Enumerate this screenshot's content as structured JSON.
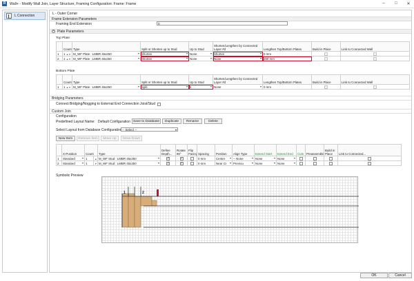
{
  "window": {
    "title": "Wall+ - Modify Wall Join, Layer Structure, Framing Configuration: Frame: Frame",
    "app_icon": "R",
    "minimize": "–",
    "maximize": "□",
    "close": "✕"
  },
  "sidebar": {
    "items": [
      {
        "label": "L Connection",
        "selected": true
      }
    ]
  },
  "header": {
    "title": "L - Outer Corner"
  },
  "frame_extension": {
    "title": "Frame Extension Parameters",
    "label": "Framing End Extension",
    "value": "0"
  },
  "plate_parameters": {
    "title": "Plate Parameters",
    "collapse_icon": "⌃",
    "columns": [
      "Count",
      "Type",
      "Split or Shorten up to Stud",
      "Up to Stud",
      "Shorten/Lengthen by Connected Layer #d",
      "Lengthen Top/Bottom Plates",
      "Build in Place",
      "Link to Connected Wall"
    ],
    "top_plate": {
      "title": "Top Plate",
      "rows": [
        {
          "num": "1",
          "count": "1",
          "type": "M_WF Plate : LMBR 45x250",
          "split": "Shorten",
          "up_to": "None",
          "shorten": "Shorten",
          "lengthen": "0 mm"
        },
        {
          "num": "2",
          "count": "1",
          "type": "M_WF Plate : LMBR 45x250",
          "split": "Shorten",
          "up_to": "None",
          "shorten": "None",
          "lengthen": "250 mm"
        }
      ]
    },
    "bottom_plate": {
      "title": "Bottom Plate",
      "rows": [
        {
          "num": "1",
          "count": "1",
          "type": "M_WF Plate : LMBR 45x250",
          "split": "Split",
          "up_to": "5",
          "shorten": "None",
          "lengthen": "0 mm"
        }
      ]
    }
  },
  "bridging": {
    "title": "Bridging Parameters",
    "label": "Connect Bridging/Nogging to External End Connection Joist/Stud"
  },
  "custom_join": {
    "title": "Custom Join",
    "configuration": {
      "title": "Configuration",
      "predefined_label": "Predefined Layout Name:",
      "predefined_value": "Default Configuration",
      "buttons": [
        "Save to Database",
        "Duplicate",
        "Rename",
        "Delete"
      ],
      "select_label": "Select Layout from Database Configuration:",
      "select_value": "-- Select --"
    },
    "item_buttons": [
      "New Item",
      "Remove Item",
      "Move Up",
      "Move Down"
    ],
    "columns": [
      "X-Position",
      "Count",
      "Type",
      "Define Depth...",
      "Rotate 90°",
      "Flip Facing",
      "Spacing",
      "Position",
      "Align Type",
      "Extend Start",
      "Extend End",
      "Cuts",
      "Preassembled",
      "Build in Place",
      "Link to Connected..."
    ],
    "rows": [
      {
        "num": "1",
        "xpos": "Standard",
        "count": "1",
        "type": "M_WF Stud : LMBR 45x250",
        "spacing": "0 mm",
        "position": "Center",
        "align": "-- None",
        "extend_start": "None",
        "extend_end": "None"
      },
      {
        "num": "2",
        "xpos": "Standard",
        "count": "1",
        "type": "M_WF Stud : LMBR 45x250",
        "spacing": "0 mm",
        "position": "Near Cr",
        "align": "Previou",
        "extend_start": "None",
        "extend_end": "None"
      }
    ]
  },
  "symbolic_preview": {
    "title": "Symbolic Preview",
    "labels": [
      "1",
      "2"
    ]
  },
  "footer": {
    "ok": "OK",
    "cancel": "Cancel"
  },
  "colors": {
    "accent": "#1e5fa8",
    "highlight": "#c8102e",
    "timber": "#d7ad79",
    "grid": "#e4e4e4"
  }
}
